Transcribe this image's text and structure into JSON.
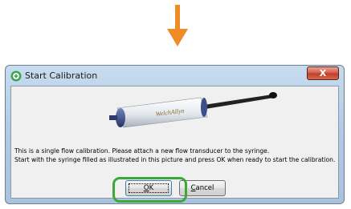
{
  "window": {
    "title": "Start Calibration",
    "close_label": "X"
  },
  "device": {
    "brand": "WelchAllyn"
  },
  "message": {
    "line1": "This is a single flow calibration. Please attach a new flow transducer to the syringe.",
    "line2": "Start with the syringe filled as illustrated in this picture and press OK when ready to start the calibration."
  },
  "buttons": {
    "ok_mnemonic": "O",
    "ok_rest": "K",
    "cancel_mnemonic": "C",
    "cancel_rest": "ancel"
  },
  "colors": {
    "arrow": "#f08c28",
    "highlight": "#3da83a",
    "title_icon": "#3aa54a"
  }
}
